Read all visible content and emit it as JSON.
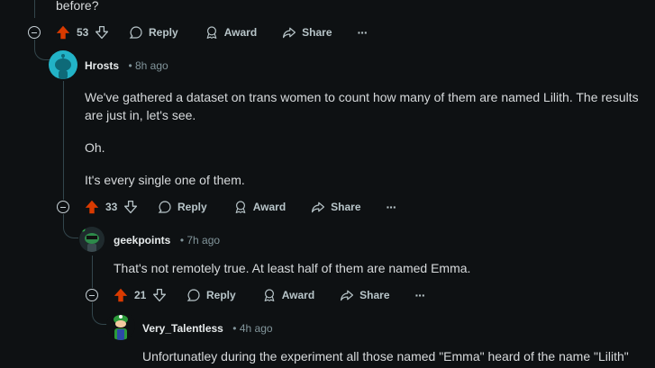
{
  "top_comment": {
    "text_tail": "before?",
    "score": "53"
  },
  "actions": {
    "reply": "Reply",
    "award": "Award",
    "share": "Share",
    "more": "···"
  },
  "comments": [
    {
      "author": "Hrosts",
      "time": "• 8h ago",
      "paragraphs": [
        "We've gathered a dataset on trans women to count how many of them are named Lilith. The results are just in, let's see.",
        "Oh.",
        "It's every single one of them."
      ],
      "score": "33"
    },
    {
      "author": "geekpoints",
      "time": "• 7h ago",
      "paragraphs": [
        "That's not remotely true. At least half of them are named Emma."
      ],
      "score": "21"
    },
    {
      "author": "Very_Talentless",
      "time": "• 4h ago",
      "paragraphs": [
        "Unfortunatley during the experiment all those named \"Emma\" heard of the name \"Lilith\""
      ]
    }
  ],
  "colors": {
    "background": "#0e1113",
    "upvote_active": "#d93a00",
    "thread_line": "#33464c"
  }
}
